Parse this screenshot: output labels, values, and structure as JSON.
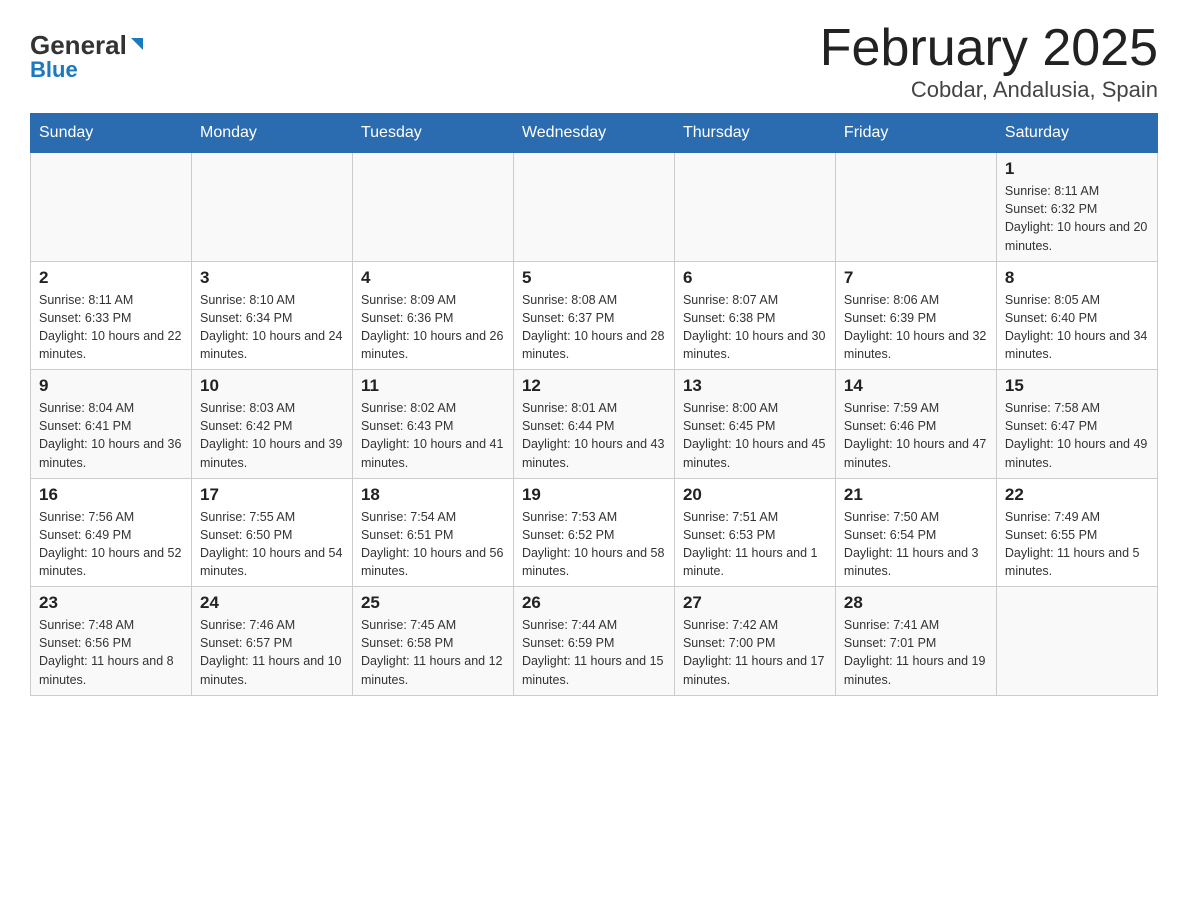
{
  "header": {
    "logo_general": "General",
    "logo_blue": "Blue",
    "title": "February 2025",
    "subtitle": "Cobdar, Andalusia, Spain"
  },
  "days_of_week": [
    "Sunday",
    "Monday",
    "Tuesday",
    "Wednesday",
    "Thursday",
    "Friday",
    "Saturday"
  ],
  "weeks": [
    {
      "days": [
        {
          "number": "",
          "info": ""
        },
        {
          "number": "",
          "info": ""
        },
        {
          "number": "",
          "info": ""
        },
        {
          "number": "",
          "info": ""
        },
        {
          "number": "",
          "info": ""
        },
        {
          "number": "",
          "info": ""
        },
        {
          "number": "1",
          "info": "Sunrise: 8:11 AM\nSunset: 6:32 PM\nDaylight: 10 hours and 20 minutes."
        }
      ]
    },
    {
      "days": [
        {
          "number": "2",
          "info": "Sunrise: 8:11 AM\nSunset: 6:33 PM\nDaylight: 10 hours and 22 minutes."
        },
        {
          "number": "3",
          "info": "Sunrise: 8:10 AM\nSunset: 6:34 PM\nDaylight: 10 hours and 24 minutes."
        },
        {
          "number": "4",
          "info": "Sunrise: 8:09 AM\nSunset: 6:36 PM\nDaylight: 10 hours and 26 minutes."
        },
        {
          "number": "5",
          "info": "Sunrise: 8:08 AM\nSunset: 6:37 PM\nDaylight: 10 hours and 28 minutes."
        },
        {
          "number": "6",
          "info": "Sunrise: 8:07 AM\nSunset: 6:38 PM\nDaylight: 10 hours and 30 minutes."
        },
        {
          "number": "7",
          "info": "Sunrise: 8:06 AM\nSunset: 6:39 PM\nDaylight: 10 hours and 32 minutes."
        },
        {
          "number": "8",
          "info": "Sunrise: 8:05 AM\nSunset: 6:40 PM\nDaylight: 10 hours and 34 minutes."
        }
      ]
    },
    {
      "days": [
        {
          "number": "9",
          "info": "Sunrise: 8:04 AM\nSunset: 6:41 PM\nDaylight: 10 hours and 36 minutes."
        },
        {
          "number": "10",
          "info": "Sunrise: 8:03 AM\nSunset: 6:42 PM\nDaylight: 10 hours and 39 minutes."
        },
        {
          "number": "11",
          "info": "Sunrise: 8:02 AM\nSunset: 6:43 PM\nDaylight: 10 hours and 41 minutes."
        },
        {
          "number": "12",
          "info": "Sunrise: 8:01 AM\nSunset: 6:44 PM\nDaylight: 10 hours and 43 minutes."
        },
        {
          "number": "13",
          "info": "Sunrise: 8:00 AM\nSunset: 6:45 PM\nDaylight: 10 hours and 45 minutes."
        },
        {
          "number": "14",
          "info": "Sunrise: 7:59 AM\nSunset: 6:46 PM\nDaylight: 10 hours and 47 minutes."
        },
        {
          "number": "15",
          "info": "Sunrise: 7:58 AM\nSunset: 6:47 PM\nDaylight: 10 hours and 49 minutes."
        }
      ]
    },
    {
      "days": [
        {
          "number": "16",
          "info": "Sunrise: 7:56 AM\nSunset: 6:49 PM\nDaylight: 10 hours and 52 minutes."
        },
        {
          "number": "17",
          "info": "Sunrise: 7:55 AM\nSunset: 6:50 PM\nDaylight: 10 hours and 54 minutes."
        },
        {
          "number": "18",
          "info": "Sunrise: 7:54 AM\nSunset: 6:51 PM\nDaylight: 10 hours and 56 minutes."
        },
        {
          "number": "19",
          "info": "Sunrise: 7:53 AM\nSunset: 6:52 PM\nDaylight: 10 hours and 58 minutes."
        },
        {
          "number": "20",
          "info": "Sunrise: 7:51 AM\nSunset: 6:53 PM\nDaylight: 11 hours and 1 minute."
        },
        {
          "number": "21",
          "info": "Sunrise: 7:50 AM\nSunset: 6:54 PM\nDaylight: 11 hours and 3 minutes."
        },
        {
          "number": "22",
          "info": "Sunrise: 7:49 AM\nSunset: 6:55 PM\nDaylight: 11 hours and 5 minutes."
        }
      ]
    },
    {
      "days": [
        {
          "number": "23",
          "info": "Sunrise: 7:48 AM\nSunset: 6:56 PM\nDaylight: 11 hours and 8 minutes."
        },
        {
          "number": "24",
          "info": "Sunrise: 7:46 AM\nSunset: 6:57 PM\nDaylight: 11 hours and 10 minutes."
        },
        {
          "number": "25",
          "info": "Sunrise: 7:45 AM\nSunset: 6:58 PM\nDaylight: 11 hours and 12 minutes."
        },
        {
          "number": "26",
          "info": "Sunrise: 7:44 AM\nSunset: 6:59 PM\nDaylight: 11 hours and 15 minutes."
        },
        {
          "number": "27",
          "info": "Sunrise: 7:42 AM\nSunset: 7:00 PM\nDaylight: 11 hours and 17 minutes."
        },
        {
          "number": "28",
          "info": "Sunrise: 7:41 AM\nSunset: 7:01 PM\nDaylight: 11 hours and 19 minutes."
        },
        {
          "number": "",
          "info": ""
        }
      ]
    }
  ]
}
